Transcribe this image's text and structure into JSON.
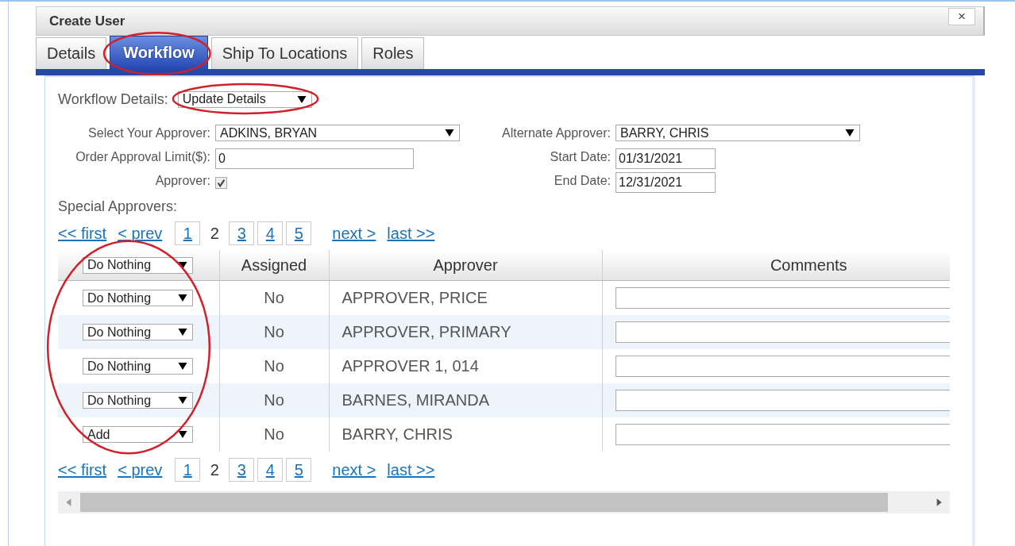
{
  "dialog": {
    "title": "Create User",
    "close": "×"
  },
  "tabs": [
    {
      "label": "Details",
      "selected": false,
      "circled": false
    },
    {
      "label": "Workflow",
      "selected": true,
      "circled": true
    },
    {
      "label": "Ship To Locations",
      "selected": false,
      "circled": false
    },
    {
      "label": "Roles",
      "selected": false,
      "circled": false
    }
  ],
  "workflow_details": {
    "label": "Workflow Details:",
    "value": "Update Details",
    "circled": true
  },
  "form_left": [
    {
      "kind": "select",
      "label": "Select Your Approver:",
      "value": "ADKINS, BRYAN"
    },
    {
      "kind": "text",
      "label": "Order Approval Limit($):",
      "value": "0"
    },
    {
      "kind": "checkbox",
      "label": "Approver:",
      "checked": true
    }
  ],
  "form_right": [
    {
      "kind": "select",
      "label": "Alternate Approver:",
      "value": "BARRY, CHRIS"
    },
    {
      "kind": "date",
      "label": "Start Date:",
      "value": "01/31/2021"
    },
    {
      "kind": "date",
      "label": "End Date:",
      "value": "12/31/2021"
    }
  ],
  "special_approvers_label": "Special Approvers:",
  "pagination_top": {
    "first": "<< first",
    "prev": "< prev",
    "pages": [
      {
        "label": "1",
        "selected": false
      },
      {
        "label": "2",
        "selected": true
      },
      {
        "label": "3",
        "selected": false
      },
      {
        "label": "4",
        "selected": false
      },
      {
        "label": "5",
        "selected": false
      }
    ],
    "next": "next >",
    "last": "last >>"
  },
  "table": {
    "action_column_circled": true,
    "header_action": "Do Nothing",
    "columns": [
      "Assigned",
      "Approver",
      "Comments"
    ],
    "rows": [
      {
        "action": "Do Nothing",
        "assigned": "No",
        "approver": "APPROVER, PRICE"
      },
      {
        "action": "Do Nothing",
        "assigned": "No",
        "approver": "APPROVER, PRIMARY"
      },
      {
        "action": "Do Nothing",
        "assigned": "No",
        "approver": "APPROVER 1, 014"
      },
      {
        "action": "Do Nothing",
        "assigned": "No",
        "approver": "BARNES, MIRANDA"
      },
      {
        "action": "Add",
        "assigned": "No",
        "approver": "BARRY, CHRIS"
      }
    ]
  },
  "pagination_bottom": {
    "first": "<< first",
    "prev": "< prev",
    "pages": [
      {
        "label": "1",
        "selected": false
      },
      {
        "label": "2",
        "selected": true
      },
      {
        "label": "3",
        "selected": false
      },
      {
        "label": "4",
        "selected": false
      },
      {
        "label": "5",
        "selected": false
      }
    ],
    "next": "next >",
    "last": "last >>"
  }
}
